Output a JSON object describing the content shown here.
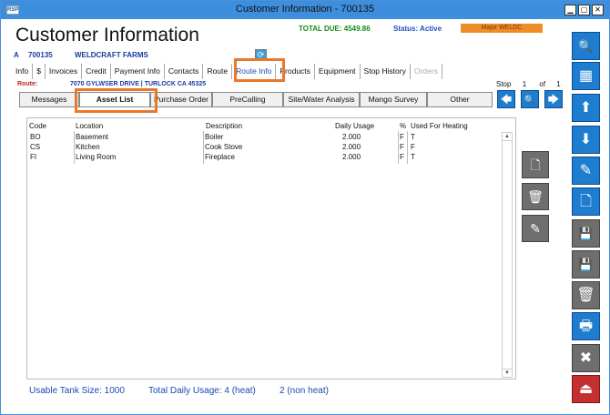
{
  "window": {
    "app_icon_label": "RSP",
    "title": "Customer Information - 700135",
    "minimize": "▁",
    "restore": "▢",
    "close": "✕"
  },
  "header": {
    "title": "Customer Information",
    "total_due": "TOTAL DUE:  4549.86",
    "status": "Status: Active",
    "major": "Major WELDC"
  },
  "customer": {
    "prefix": "A",
    "number": "700135",
    "name": "WELDCRAFT FARMS",
    "refresh_icon": "⟳"
  },
  "tabs_primary": [
    {
      "label": "Info"
    },
    {
      "label": "$"
    },
    {
      "label": "Invoices"
    },
    {
      "label": "Credit"
    },
    {
      "label": "Payment Info"
    },
    {
      "label": "Contacts"
    },
    {
      "label": "Route"
    },
    {
      "label": "Route Info"
    },
    {
      "label": "Products"
    },
    {
      "label": "Equipment"
    },
    {
      "label": "Stop History"
    },
    {
      "label": "Orders"
    }
  ],
  "route": {
    "label": "Route:",
    "address": "7070 GYLWSER DRIVE | TURLOCK CA 45325"
  },
  "stop_nav": {
    "label": "Stop",
    "current": "1",
    "of": "of",
    "total": "1",
    "prev_icon": "🡄",
    "search_icon": "🔍",
    "next_icon": "🡆"
  },
  "tabs_secondary": [
    {
      "label": "Messages"
    },
    {
      "label": "Asset List"
    },
    {
      "label": "Purchase Order"
    },
    {
      "label": "PreCalling"
    },
    {
      "label": "Site/Water Analysis"
    },
    {
      "label": "Mango Survey"
    },
    {
      "label": "Other"
    }
  ],
  "table": {
    "columns": [
      "Code",
      "Location",
      "Description",
      "Daily Usage",
      "%",
      "Used For Heating"
    ],
    "rows": [
      {
        "code": "BO",
        "location": "Basement",
        "description": "Boiler",
        "daily_usage": "2.000",
        "pct": "F",
        "heating": "T"
      },
      {
        "code": "CS",
        "location": "Kitchen",
        "description": "Cook Stove",
        "daily_usage": "2.000",
        "pct": "F",
        "heating": "F"
      },
      {
        "code": "FI",
        "location": "Living Room",
        "description": "Fireplace",
        "daily_usage": "2.000",
        "pct": "F",
        "heating": "T"
      }
    ],
    "scroll_up": "▲",
    "scroll_down": "▼"
  },
  "side_actions": {
    "add_icon": "🗋",
    "delete_icon": "🗑",
    "edit_icon": "✎"
  },
  "footer": {
    "tank_size": "Usable Tank Size: 1000",
    "total_usage": "Total Daily Usage: 4 (heat)",
    "non_heat": "2 (non heat)"
  },
  "right_toolbar": {
    "search_icon": "🔍",
    "grid_icon": "▦",
    "up_icon": "⬆",
    "down_icon": "⬇",
    "edit_icon": "✎",
    "new_icon": "🗋",
    "save_new_icon": "💾",
    "save_icon": "💾",
    "delete_icon": "🗑",
    "print_icon": "🖶",
    "cancel_icon": "✖",
    "exit_icon": "⏏"
  }
}
